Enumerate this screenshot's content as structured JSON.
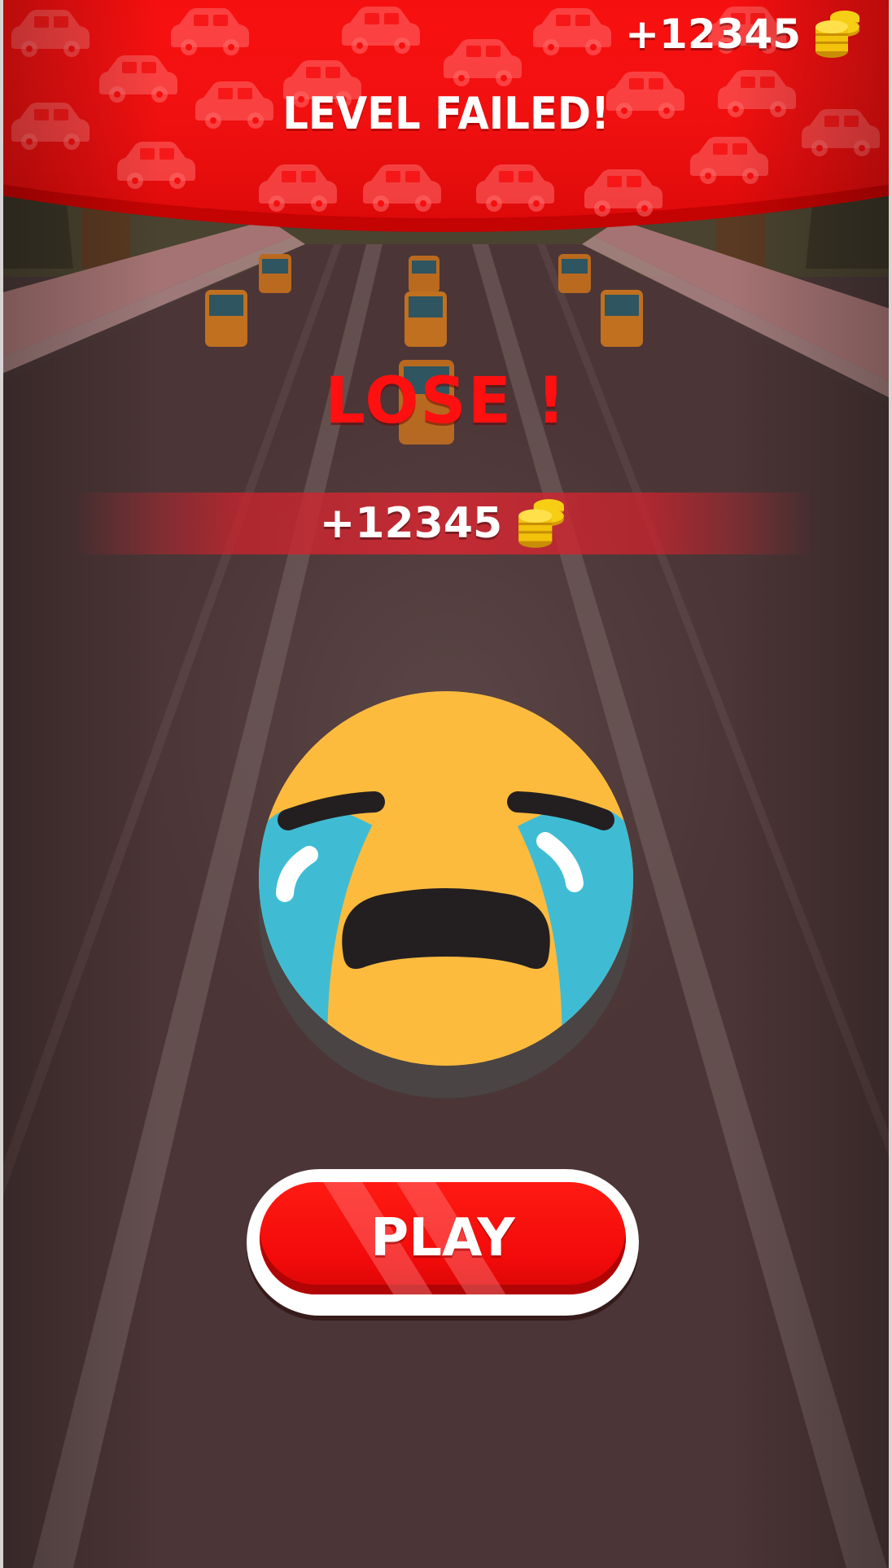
{
  "header": {
    "title": "LEVEL FAILED!",
    "coin_total": "+12345",
    "coin_icon": "coin-stack-icon"
  },
  "result": {
    "message": "LOSE !",
    "reward_amount": "+12345",
    "reward_icon": "coin-stack-icon",
    "emoji_icon": "crying-face-icon"
  },
  "actions": {
    "play_label": "PLAY"
  },
  "colors": {
    "banner_red": "#f60f0f",
    "lose_red": "#ff1010",
    "coin_gold": "#f2c20c",
    "emoji_face": "#fdbb3e",
    "emoji_tears": "#3fbcd4"
  }
}
